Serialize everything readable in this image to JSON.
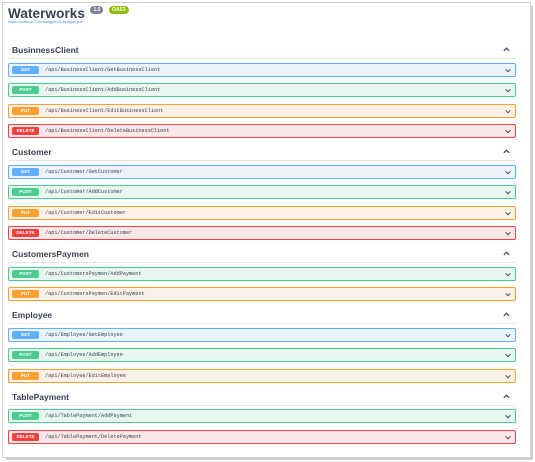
{
  "app": {
    "title": "Waterworks",
    "version_badge": "1.0",
    "oas_badge": "OAS3",
    "spec_link": "https://localhost:7194/swagger/v1/swagger.json"
  },
  "colors": {
    "get": "#61affe",
    "post": "#49cc90",
    "put": "#fca130",
    "delete": "#f93e3e"
  },
  "sections": [
    {
      "name": "BusinnessClient",
      "operations": [
        {
          "method": "GET",
          "path": "/api/BusinessClient/GetBusinessClient"
        },
        {
          "method": "POST",
          "path": "/api/BusinessClient/AddBusinessClient"
        },
        {
          "method": "PUT",
          "path": "/api/BusinessClient/EditBusinessClient"
        },
        {
          "method": "DELETE",
          "path": "/api/BusinessClient/DeleteBusinessClient"
        }
      ]
    },
    {
      "name": "Customer",
      "operations": [
        {
          "method": "GET",
          "path": "/api/Customer/GetCustomer"
        },
        {
          "method": "POST",
          "path": "/api/Customer/AddCustomer"
        },
        {
          "method": "PUT",
          "path": "/api/Customer/EditCustomer"
        },
        {
          "method": "DELETE",
          "path": "/api/Customer/DeleteCustomer"
        }
      ]
    },
    {
      "name": "CustomersPaymen",
      "operations": [
        {
          "method": "POST",
          "path": "/api/CustomersPaymen/AddPayment"
        },
        {
          "method": "PUT",
          "path": "/api/CustomersPaymen/EditPayment"
        }
      ]
    },
    {
      "name": "Employee",
      "operations": [
        {
          "method": "GET",
          "path": "/api/Employee/GetEmployee"
        },
        {
          "method": "POST",
          "path": "/api/Employee/AddEmployee"
        },
        {
          "method": "PUT",
          "path": "/api/Employee/EditEmployee"
        }
      ]
    },
    {
      "name": "TablePayment",
      "operations": [
        {
          "method": "POST",
          "path": "/api/TablePayment/AddPayment"
        },
        {
          "method": "DELETE",
          "path": "/api/TablePayment/DeletePayment"
        }
      ]
    }
  ]
}
